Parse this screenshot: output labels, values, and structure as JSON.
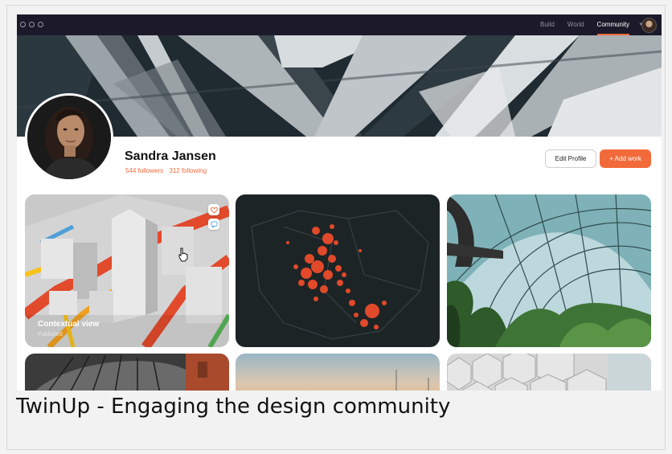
{
  "window": {
    "controls": [
      "close",
      "minimize",
      "maximize"
    ]
  },
  "nav": {
    "items": [
      {
        "label": "Build"
      },
      {
        "label": "World"
      },
      {
        "label": "Community",
        "active": true
      }
    ],
    "dropdown_icon": "chevron-down-icon",
    "user_avatar_icon": "avatar-icon"
  },
  "profile": {
    "name": "Sandra Jansen",
    "followers": "544 followers",
    "following": "312 following",
    "edit_label": "Edit Profile",
    "add_label": "+ Add work"
  },
  "cards": [
    {
      "title": "Contextual view",
      "status": "Published",
      "actions": [
        "heart-icon",
        "chat-icon"
      ]
    },
    {
      "title": "",
      "status": ""
    },
    {
      "title": "",
      "status": ""
    },
    {
      "title": "",
      "status": ""
    },
    {
      "title": "",
      "status": ""
    },
    {
      "title": "",
      "status": ""
    }
  ],
  "caption": "TwinUp - Engaging the design community",
  "colors": {
    "accent": "#f26a3a",
    "topbar": "#1c1a2a",
    "map_bg": "#1d2426",
    "map_dots": "#e0492a"
  }
}
